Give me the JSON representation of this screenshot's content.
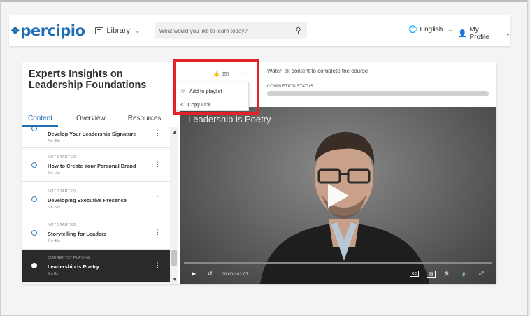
{
  "nav": {
    "logo_text": "percipio",
    "library_label": "Library",
    "search_placeholder": "What would you like to learn today?",
    "language_label": "English",
    "profile_label": "My Profile"
  },
  "course": {
    "title": "Experts Insights on Leadership Foundations",
    "likes": "557",
    "watch_message": "Watch all content to complete the course",
    "completion_label": "COMPLETION STATUS",
    "completion_progress": 0
  },
  "tabs": [
    "Content",
    "Overview",
    "Resources"
  ],
  "items": [
    {
      "status": "",
      "name": "Develop Your Leadership Signature",
      "duration": "4m 28s"
    },
    {
      "status": "NOT STARTED",
      "name": "How to Create Your Personal Brand",
      "duration": "6m 16s"
    },
    {
      "status": "NOT STARTED",
      "name": "Developing Executive Presence",
      "duration": "6m 28s"
    },
    {
      "status": "NOT STARTED",
      "name": "Storytelling for Leaders",
      "duration": "2m 46s"
    },
    {
      "status": "CURRENTLY PLAYING",
      "name": "Leadership is Poetry",
      "duration": "3m 8s"
    }
  ],
  "video": {
    "title": "Leadership is Poetry",
    "current_time": "00:00",
    "total_time": "02:07"
  },
  "menu": {
    "add_to_playlist": "Add to playlist",
    "copy_link": "Copy Link"
  },
  "colors": {
    "brand": "#1f6fb5",
    "highlight": "#e5202a"
  }
}
